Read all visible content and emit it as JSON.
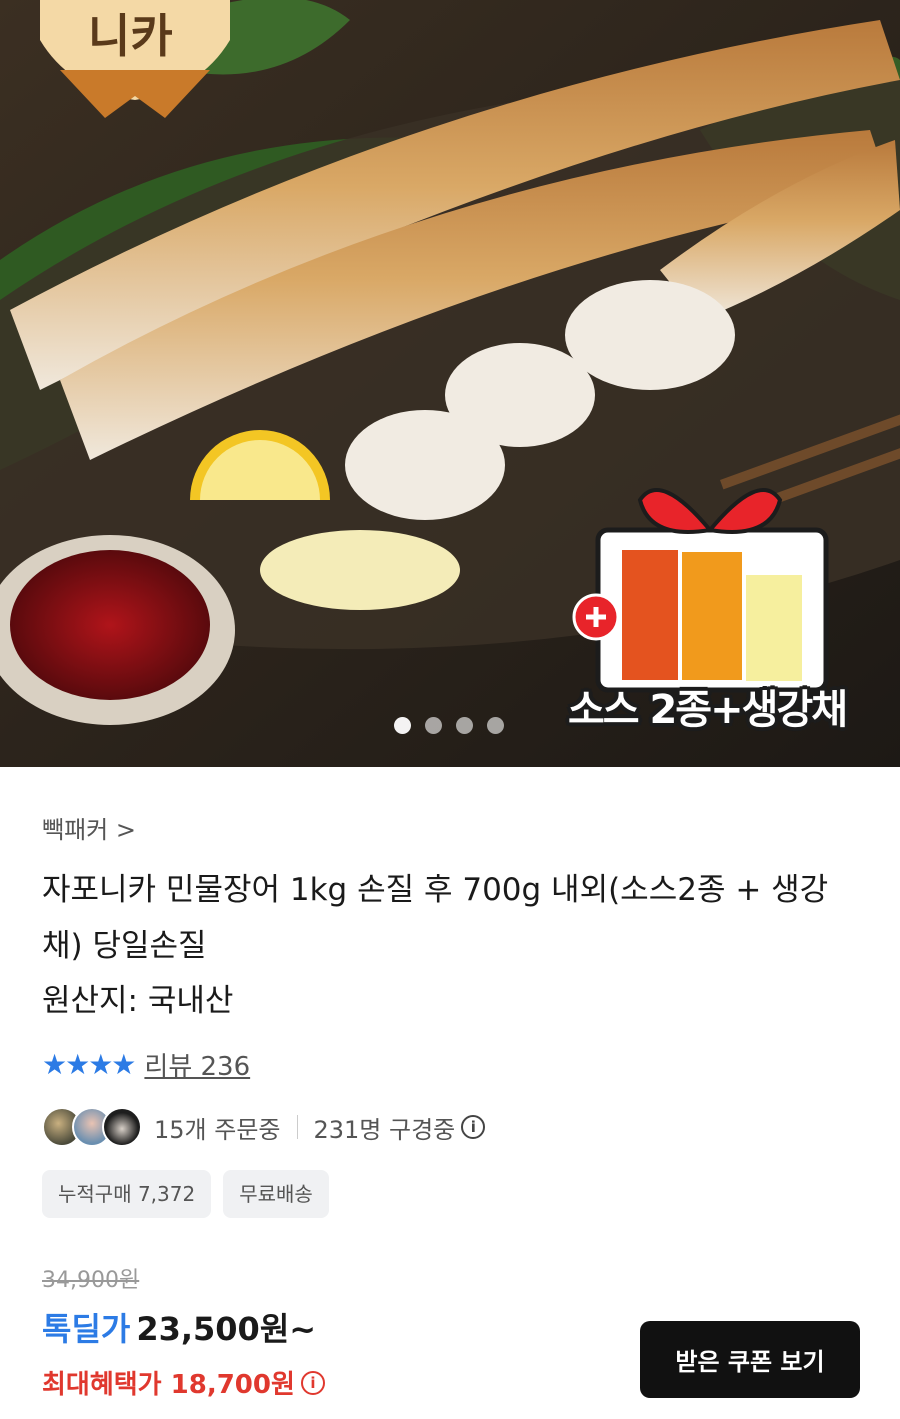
{
  "hero": {
    "badge_text": "니카",
    "promo_label": "소스 2종+생강채",
    "carousel_total": 4,
    "carousel_active": 1
  },
  "product": {
    "seller": "빽패커 >",
    "title": "자포니카 민물장어 1kg 손질 후 700g 내외(소스2종 + 생강채) 당일손질",
    "origin": "원산지: 국내산"
  },
  "rating": {
    "stars": "★★★★",
    "review_label": "리뷰 236"
  },
  "social": {
    "orders": "15개 주문중",
    "viewers": "231명 구경중",
    "info_icon": "i"
  },
  "chips": [
    "누적구매 7,372",
    "무료배송"
  ],
  "price": {
    "original": "34,900원",
    "deal_label": "톡딜가",
    "deal_value": "23,500원~",
    "max_benefit": "최대혜택가 18,700원",
    "info_icon": "i"
  },
  "coupon_button": "받은 쿠폰 보기",
  "colors": {
    "accent_blue": "#2c7be5",
    "accent_red": "#e0382e",
    "button_dark": "#111111"
  }
}
